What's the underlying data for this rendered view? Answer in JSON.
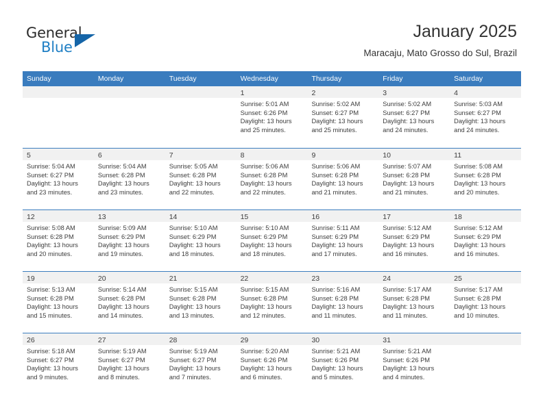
{
  "brand": {
    "name_part1": "General",
    "name_part2": "Blue",
    "triangle_icon": "triangle-icon",
    "accent_color": "#1f7fc4",
    "triangle_color": "#1565a8"
  },
  "header": {
    "month_title": "January 2025",
    "location": "Maracaju, Mato Grosso do Sul, Brazil"
  },
  "calendar": {
    "header_color": "#3a7cbe",
    "daynum_strip_color": "#f1f1f1",
    "weekdays": [
      "Sunday",
      "Monday",
      "Tuesday",
      "Wednesday",
      "Thursday",
      "Friday",
      "Saturday"
    ],
    "weeks": [
      [
        {
          "day": "",
          "empty": true,
          "sunrise": "",
          "sunset": "",
          "daylight1": "",
          "daylight2": ""
        },
        {
          "day": "",
          "empty": true,
          "sunrise": "",
          "sunset": "",
          "daylight1": "",
          "daylight2": ""
        },
        {
          "day": "",
          "empty": true,
          "sunrise": "",
          "sunset": "",
          "daylight1": "",
          "daylight2": ""
        },
        {
          "day": "1",
          "empty": false,
          "sunrise": "Sunrise: 5:01 AM",
          "sunset": "Sunset: 6:26 PM",
          "daylight1": "Daylight: 13 hours",
          "daylight2": "and 25 minutes."
        },
        {
          "day": "2",
          "empty": false,
          "sunrise": "Sunrise: 5:02 AM",
          "sunset": "Sunset: 6:27 PM",
          "daylight1": "Daylight: 13 hours",
          "daylight2": "and 25 minutes."
        },
        {
          "day": "3",
          "empty": false,
          "sunrise": "Sunrise: 5:02 AM",
          "sunset": "Sunset: 6:27 PM",
          "daylight1": "Daylight: 13 hours",
          "daylight2": "and 24 minutes."
        },
        {
          "day": "4",
          "empty": false,
          "sunrise": "Sunrise: 5:03 AM",
          "sunset": "Sunset: 6:27 PM",
          "daylight1": "Daylight: 13 hours",
          "daylight2": "and 24 minutes."
        }
      ],
      [
        {
          "day": "5",
          "empty": false,
          "sunrise": "Sunrise: 5:04 AM",
          "sunset": "Sunset: 6:27 PM",
          "daylight1": "Daylight: 13 hours",
          "daylight2": "and 23 minutes."
        },
        {
          "day": "6",
          "empty": false,
          "sunrise": "Sunrise: 5:04 AM",
          "sunset": "Sunset: 6:28 PM",
          "daylight1": "Daylight: 13 hours",
          "daylight2": "and 23 minutes."
        },
        {
          "day": "7",
          "empty": false,
          "sunrise": "Sunrise: 5:05 AM",
          "sunset": "Sunset: 6:28 PM",
          "daylight1": "Daylight: 13 hours",
          "daylight2": "and 22 minutes."
        },
        {
          "day": "8",
          "empty": false,
          "sunrise": "Sunrise: 5:06 AM",
          "sunset": "Sunset: 6:28 PM",
          "daylight1": "Daylight: 13 hours",
          "daylight2": "and 22 minutes."
        },
        {
          "day": "9",
          "empty": false,
          "sunrise": "Sunrise: 5:06 AM",
          "sunset": "Sunset: 6:28 PM",
          "daylight1": "Daylight: 13 hours",
          "daylight2": "and 21 minutes."
        },
        {
          "day": "10",
          "empty": false,
          "sunrise": "Sunrise: 5:07 AM",
          "sunset": "Sunset: 6:28 PM",
          "daylight1": "Daylight: 13 hours",
          "daylight2": "and 21 minutes."
        },
        {
          "day": "11",
          "empty": false,
          "sunrise": "Sunrise: 5:08 AM",
          "sunset": "Sunset: 6:28 PM",
          "daylight1": "Daylight: 13 hours",
          "daylight2": "and 20 minutes."
        }
      ],
      [
        {
          "day": "12",
          "empty": false,
          "sunrise": "Sunrise: 5:08 AM",
          "sunset": "Sunset: 6:28 PM",
          "daylight1": "Daylight: 13 hours",
          "daylight2": "and 20 minutes."
        },
        {
          "day": "13",
          "empty": false,
          "sunrise": "Sunrise: 5:09 AM",
          "sunset": "Sunset: 6:29 PM",
          "daylight1": "Daylight: 13 hours",
          "daylight2": "and 19 minutes."
        },
        {
          "day": "14",
          "empty": false,
          "sunrise": "Sunrise: 5:10 AM",
          "sunset": "Sunset: 6:29 PM",
          "daylight1": "Daylight: 13 hours",
          "daylight2": "and 18 minutes."
        },
        {
          "day": "15",
          "empty": false,
          "sunrise": "Sunrise: 5:10 AM",
          "sunset": "Sunset: 6:29 PM",
          "daylight1": "Daylight: 13 hours",
          "daylight2": "and 18 minutes."
        },
        {
          "day": "16",
          "empty": false,
          "sunrise": "Sunrise: 5:11 AM",
          "sunset": "Sunset: 6:29 PM",
          "daylight1": "Daylight: 13 hours",
          "daylight2": "and 17 minutes."
        },
        {
          "day": "17",
          "empty": false,
          "sunrise": "Sunrise: 5:12 AM",
          "sunset": "Sunset: 6:29 PM",
          "daylight1": "Daylight: 13 hours",
          "daylight2": "and 16 minutes."
        },
        {
          "day": "18",
          "empty": false,
          "sunrise": "Sunrise: 5:12 AM",
          "sunset": "Sunset: 6:29 PM",
          "daylight1": "Daylight: 13 hours",
          "daylight2": "and 16 minutes."
        }
      ],
      [
        {
          "day": "19",
          "empty": false,
          "sunrise": "Sunrise: 5:13 AM",
          "sunset": "Sunset: 6:28 PM",
          "daylight1": "Daylight: 13 hours",
          "daylight2": "and 15 minutes."
        },
        {
          "day": "20",
          "empty": false,
          "sunrise": "Sunrise: 5:14 AM",
          "sunset": "Sunset: 6:28 PM",
          "daylight1": "Daylight: 13 hours",
          "daylight2": "and 14 minutes."
        },
        {
          "day": "21",
          "empty": false,
          "sunrise": "Sunrise: 5:15 AM",
          "sunset": "Sunset: 6:28 PM",
          "daylight1": "Daylight: 13 hours",
          "daylight2": "and 13 minutes."
        },
        {
          "day": "22",
          "empty": false,
          "sunrise": "Sunrise: 5:15 AM",
          "sunset": "Sunset: 6:28 PM",
          "daylight1": "Daylight: 13 hours",
          "daylight2": "and 12 minutes."
        },
        {
          "day": "23",
          "empty": false,
          "sunrise": "Sunrise: 5:16 AM",
          "sunset": "Sunset: 6:28 PM",
          "daylight1": "Daylight: 13 hours",
          "daylight2": "and 11 minutes."
        },
        {
          "day": "24",
          "empty": false,
          "sunrise": "Sunrise: 5:17 AM",
          "sunset": "Sunset: 6:28 PM",
          "daylight1": "Daylight: 13 hours",
          "daylight2": "and 11 minutes."
        },
        {
          "day": "25",
          "empty": false,
          "sunrise": "Sunrise: 5:17 AM",
          "sunset": "Sunset: 6:28 PM",
          "daylight1": "Daylight: 13 hours",
          "daylight2": "and 10 minutes."
        }
      ],
      [
        {
          "day": "26",
          "empty": false,
          "sunrise": "Sunrise: 5:18 AM",
          "sunset": "Sunset: 6:27 PM",
          "daylight1": "Daylight: 13 hours",
          "daylight2": "and 9 minutes."
        },
        {
          "day": "27",
          "empty": false,
          "sunrise": "Sunrise: 5:19 AM",
          "sunset": "Sunset: 6:27 PM",
          "daylight1": "Daylight: 13 hours",
          "daylight2": "and 8 minutes."
        },
        {
          "day": "28",
          "empty": false,
          "sunrise": "Sunrise: 5:19 AM",
          "sunset": "Sunset: 6:27 PM",
          "daylight1": "Daylight: 13 hours",
          "daylight2": "and 7 minutes."
        },
        {
          "day": "29",
          "empty": false,
          "sunrise": "Sunrise: 5:20 AM",
          "sunset": "Sunset: 6:26 PM",
          "daylight1": "Daylight: 13 hours",
          "daylight2": "and 6 minutes."
        },
        {
          "day": "30",
          "empty": false,
          "sunrise": "Sunrise: 5:21 AM",
          "sunset": "Sunset: 6:26 PM",
          "daylight1": "Daylight: 13 hours",
          "daylight2": "and 5 minutes."
        },
        {
          "day": "31",
          "empty": false,
          "sunrise": "Sunrise: 5:21 AM",
          "sunset": "Sunset: 6:26 PM",
          "daylight1": "Daylight: 13 hours",
          "daylight2": "and 4 minutes."
        },
        {
          "day": "",
          "empty": true,
          "sunrise": "",
          "sunset": "",
          "daylight1": "",
          "daylight2": ""
        }
      ]
    ]
  }
}
